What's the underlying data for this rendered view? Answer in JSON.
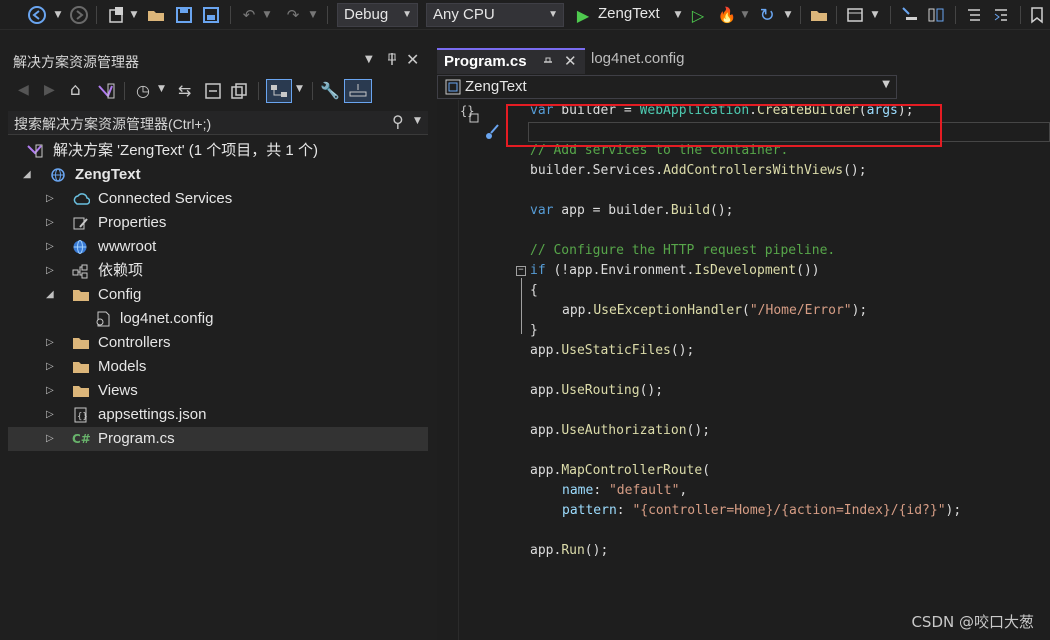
{
  "toolbar": {
    "config": "Debug",
    "platform": "Any CPU",
    "startup": "ZengText"
  },
  "solution_explorer": {
    "title": "解决方案资源管理器",
    "search_placeholder": "搜索解决方案资源管理器(Ctrl+;)",
    "solution_label": "解决方案 'ZengText' (1 个项目，共 1 个)",
    "project": "ZengText",
    "items": [
      {
        "label": "Connected Services"
      },
      {
        "label": "Properties"
      },
      {
        "label": "wwwroot"
      },
      {
        "label": "依赖项"
      },
      {
        "label": "Config"
      },
      {
        "label": "log4net.config"
      },
      {
        "label": "Controllers"
      },
      {
        "label": "Models"
      },
      {
        "label": "Views"
      },
      {
        "label": "appsettings.json"
      },
      {
        "label": "Program.cs"
      }
    ]
  },
  "editor": {
    "active_tab": "Program.cs",
    "other_tab": "log4net.config",
    "nav_scope": "ZengText"
  },
  "watermark": "CSDN @咬口大葱"
}
